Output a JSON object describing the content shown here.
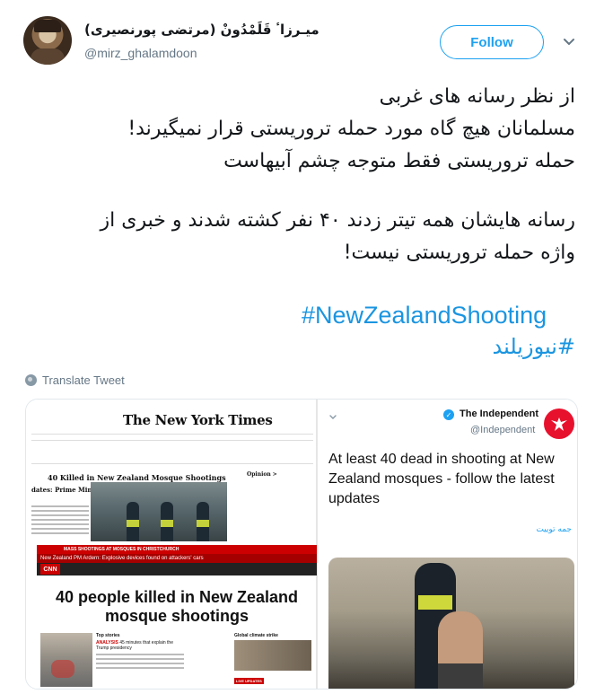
{
  "tweet": {
    "display_name": "(میـرزاٴ قَلَمْدُونْ (مرتضی پورنصیری",
    "handle": "@mirz_ghalamdoon",
    "follow_label": "Follow",
    "lines": [
      "از نظر رسانه های غربی",
      "مسلمانان هیچ گاه مورد حمله تروریستی قرار نمیگیرند!",
      "حمله تروریستی فقط متوجه چشم آبیهاست",
      "رسانه هایشان همه تیتر زدند ۴۰ نفر کشته شدند و خبری از",
      "واژه حمله تروریستی نیست!"
    ],
    "hashtag_en": "#NewZealandShooting",
    "hashtag_fa": "#نیوزیلند",
    "translate_label": "Translate Tweet"
  },
  "media": {
    "nyt": {
      "logo": "The New York Times",
      "headline": "40 Killed in New Zealand Mosque Shootings",
      "sub_headline": "dates: Prime Minister s 'Terrorist Attack'",
      "opinion": "Opinion >"
    },
    "cnn": {
      "logo": "CNN",
      "banner": "MASS SHOOTINGS AT MOSQUES IN CHRISTCHURCH",
      "banner_sub": "New Zealand PM Ardern: Explosive devices found on attackers' cars",
      "headline": "40 people killed in New Zealand mosque shootings",
      "top_stories": "Top stories",
      "analysis_label": "ANALYSIS",
      "analysis_text": "45 minutes that explain the Trump presidency",
      "climate": "Global climate strike",
      "live": "LIVE UPDATES"
    },
    "independent": {
      "name": "The Independent",
      "handle": "@Independent",
      "text": "At least 40 dead in shooting at New Zealand mosques - follow the latest updates",
      "translate": "جمه توییت"
    }
  },
  "colors": {
    "accent": "#1da1f2",
    "hashtag": "#1b95e0",
    "cnn_red": "#cc0000",
    "independent_red": "#e8112d"
  },
  "icons": {
    "chevron": "chevron-down-icon",
    "globe": "globe-icon",
    "verified": "verified-badge-icon",
    "eagle": "independent-eagle-icon"
  }
}
